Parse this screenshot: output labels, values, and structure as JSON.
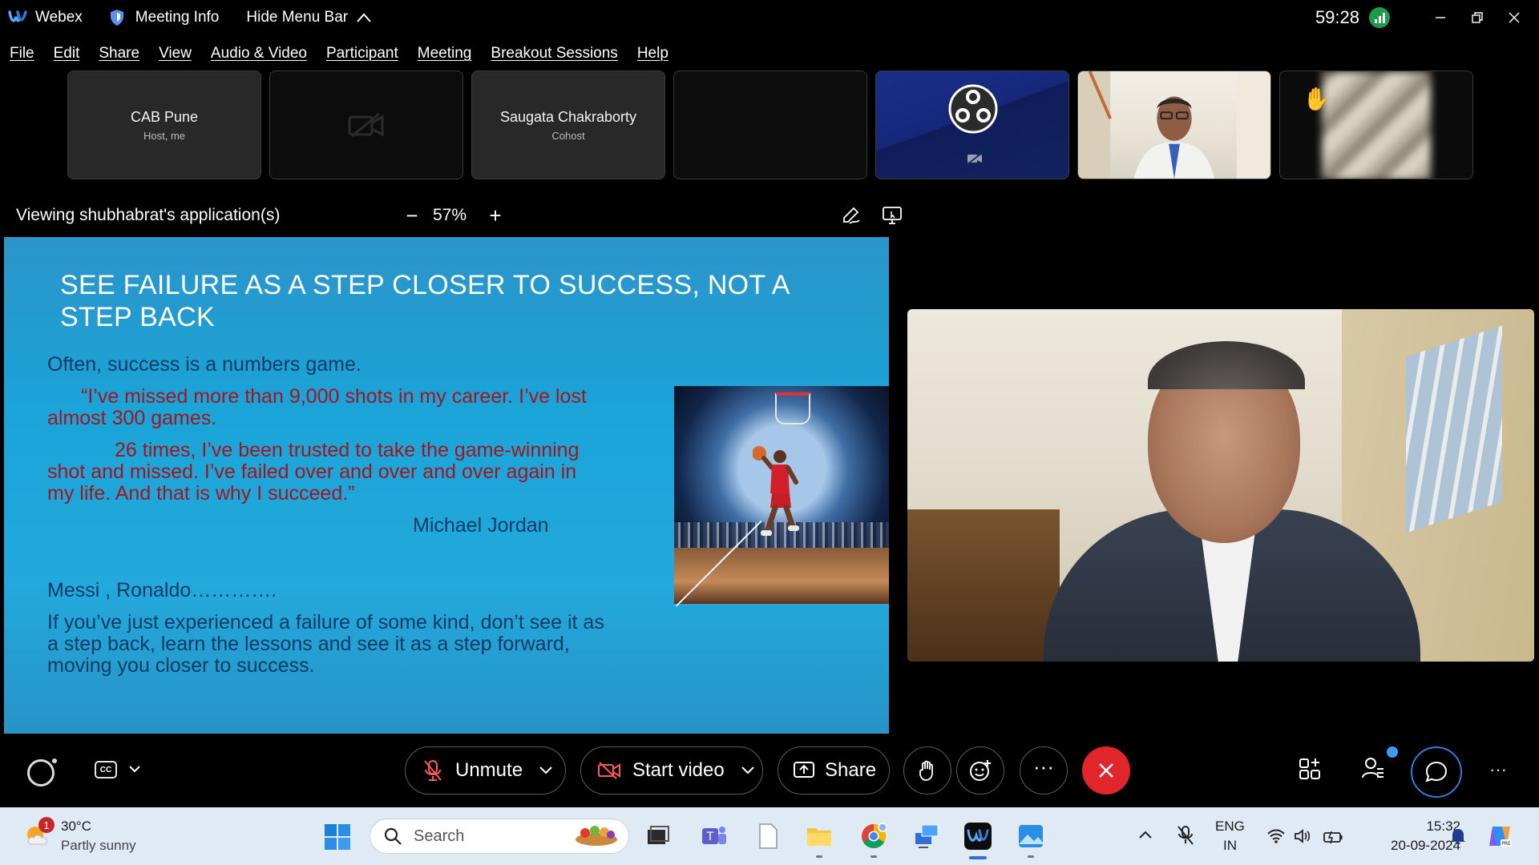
{
  "titlebar": {
    "app_name": "Webex",
    "meeting_info": "Meeting Info",
    "hide_menu": "Hide Menu Bar",
    "timer": "59:28"
  },
  "menu": [
    "File",
    "Edit",
    "Share",
    "View",
    "Audio & Video",
    "Participant",
    "Meeting",
    "Breakout Sessions",
    "Help"
  ],
  "participants": [
    {
      "name": "CAB Pune",
      "role": "Host, me"
    },
    {
      "name": "",
      "role": ""
    },
    {
      "name": "Saugata Chakraborty",
      "role": "Cohost"
    }
  ],
  "viewing": {
    "label": "Viewing shubhabrat's application(s)",
    "zoom": "57%",
    "minus": "−",
    "plus": "+"
  },
  "slide": {
    "title": "SEE FAILURE AS A STEP CLOSER TO SUCCESS, NOT A STEP BACK",
    "line1": "Often, success is a numbers game.",
    "quote1a": "“I’ve missed more than 9,000 shots in my career. I’ve lost",
    "quote1b": "almost 300 games.",
    "quote2a": "26 times, I’ve been trusted to take the game-winning",
    "quote2b": "shot and missed. I’ve failed over and over and over again in",
    "quote2c": "my life. And that is why I succeed.”",
    "author": "Michael Jordan",
    "line2": "Messi , Ronaldo………….",
    "para1": "If you’ve just experienced a failure of some kind, don’t see it as",
    "para2": "a step back, learn the lessons and see it as a step forward,",
    "para3": "moving you closer to success."
  },
  "controls": {
    "unmute": "Unmute",
    "start_video": "Start video",
    "share": "Share",
    "more": "···",
    "cc": "CC",
    "menu_dots": "···"
  },
  "taskbar": {
    "temperature": "30°C",
    "condition": "Partly sunny",
    "weather_badge": "1",
    "search_placeholder": "Search",
    "lang_top": "ENG",
    "lang_bottom": "IN",
    "time": "15:32",
    "date": "20-09-2024"
  },
  "colors": {
    "slide_red": "#a3151d",
    "slide_blue": "#0c3c66",
    "end_call": "#e0262b",
    "accent": "#2f7dd8",
    "signal": "#1d9b4c"
  }
}
